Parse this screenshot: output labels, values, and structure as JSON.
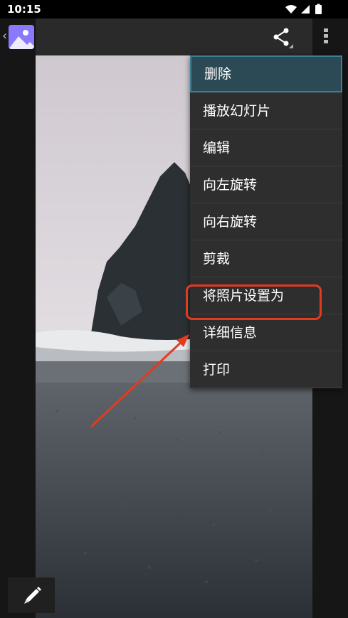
{
  "status_bar": {
    "time": "10:15"
  },
  "toolbar": {
    "back_icon": "chevron-left-icon",
    "app_icon": "gallery-app-icon",
    "share_icon": "share-icon",
    "overflow_icon": "more-vert-icon"
  },
  "menu": {
    "items": [
      {
        "label": "删除"
      },
      {
        "label": "播放幻灯片"
      },
      {
        "label": "编辑"
      },
      {
        "label": "向左旋转"
      },
      {
        "label": "向右旋转"
      },
      {
        "label": "剪裁"
      },
      {
        "label": "将照片设置为"
      },
      {
        "label": "详细信息"
      },
      {
        "label": "打印"
      }
    ]
  },
  "colors": {
    "highlight": "#e23b20",
    "menu_bg": "#2e2e2e",
    "menu_selected_bg": "#2c4a55"
  }
}
